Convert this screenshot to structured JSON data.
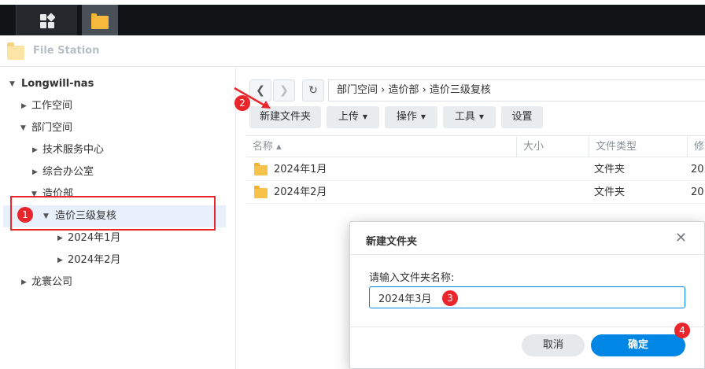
{
  "app": {
    "title": "File Station"
  },
  "sidebar": {
    "root": "Longwill-nas",
    "items": [
      {
        "label": "工作空间"
      },
      {
        "label": "部门空间"
      },
      {
        "label": "技术服务中心"
      },
      {
        "label": "综合办公室"
      },
      {
        "label": "造价部"
      },
      {
        "label": "造价三级复核"
      },
      {
        "label": "2024年1月"
      },
      {
        "label": "2024年2月"
      },
      {
        "label": "龙寰公司"
      }
    ]
  },
  "breadcrumb": {
    "path": "部门空间 › 造价部 › 造价三级复核"
  },
  "toolbar": {
    "new_folder": "新建文件夹",
    "upload": "上传",
    "action": "操作",
    "tools": "工具",
    "settings": "设置"
  },
  "table": {
    "headers": {
      "name": "名称 ▴",
      "size": "大小",
      "type": "文件类型",
      "modified": "修"
    },
    "rows": [
      {
        "name": "2024年1月",
        "size": "",
        "type": "文件夹",
        "modified": "20"
      },
      {
        "name": "2024年2月",
        "size": "",
        "type": "文件夹",
        "modified": "20"
      }
    ]
  },
  "dialog": {
    "title": "新建文件夹",
    "label": "请输入文件夹名称:",
    "value": "2024年3月",
    "cancel": "取消",
    "ok": "确定"
  },
  "annotations": {
    "b1": "1",
    "b2": "2",
    "b3": "3",
    "b4": "4"
  },
  "colors": {
    "accent": "#0086e5",
    "annotation": "#e8262b",
    "selection": "#e8f1fb"
  }
}
